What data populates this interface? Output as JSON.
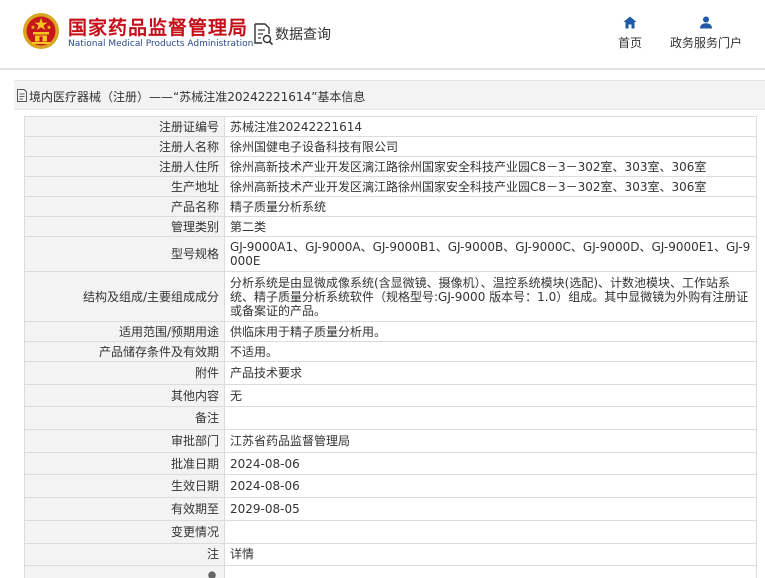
{
  "header": {
    "title_cn": "国家药品监督管理局",
    "title_en": "National Medical Products Administration",
    "query_label": "数据查询",
    "nav": {
      "home_label": "首页",
      "service_label": "政务服务门户"
    }
  },
  "breadcrumb": {
    "text": "境内医疗器械（注册）——“苏械注准20242221614”基本信息"
  },
  "record": {
    "rows": [
      {
        "label": "注册证编号",
        "value": "苏械注准20242221614"
      },
      {
        "label": "注册人名称",
        "value": "徐州国健电子设备科技有限公司"
      },
      {
        "label": "注册人住所",
        "value": "徐州高新技术产业开发区漓江路徐州国家安全科技产业园C8－3－302室、303室、306室"
      },
      {
        "label": "生产地址",
        "value": "徐州高新技术产业开发区漓江路徐州国家安全科技产业园C8－3－302室、303室、306室"
      },
      {
        "label": "产品名称",
        "value": "精子质量分析系统"
      },
      {
        "label": "管理类别",
        "value": "第二类"
      },
      {
        "label": "型号规格",
        "value": "GJ-9000A1、GJ-9000A、GJ-9000B1、GJ-9000B、GJ-9000C、GJ-9000D、GJ-9000E1、GJ-9000E"
      },
      {
        "label": "结构及组成/主要组成成分",
        "value": "分析系统是由显微成像系统(含显微镜、摄像机）、温控系统模块(选配)、计数池模块、工作站系统、精子质量分析系统软件（规格型号:GJ-9000 版本号：1.0）组成。其中显微镜为外购有注册证或备案证的产品。"
      },
      {
        "label": "适用范围/预期用途",
        "value": "供临床用于精子质量分析用。"
      },
      {
        "label": "产品储存条件及有效期",
        "value": "不适用。"
      },
      {
        "label": "附件",
        "value": "产品技术要求"
      },
      {
        "label": "其他内容",
        "value": "无"
      },
      {
        "label": "备注",
        "value": ""
      },
      {
        "label": "审批部门",
        "value": "江苏省药品监督管理局"
      },
      {
        "label": "批准日期",
        "value": "2024-08-06"
      },
      {
        "label": "生效日期",
        "value": "2024-08-06"
      },
      {
        "label": "有效期至",
        "value": "2029-08-05"
      },
      {
        "label": "变更情况",
        "value": ""
      },
      {
        "label": "注",
        "value": "详情"
      }
    ]
  },
  "colors": {
    "title_red": "#c5101a",
    "title_blue": "#2a4a8c",
    "link_blue": "#2a6fb8",
    "nav_blue": "#1e5aa6"
  },
  "icons": [
    "national-emblem-icon",
    "search-document-icon",
    "home-icon",
    "user-icon",
    "document-icon",
    "note-icon"
  ]
}
